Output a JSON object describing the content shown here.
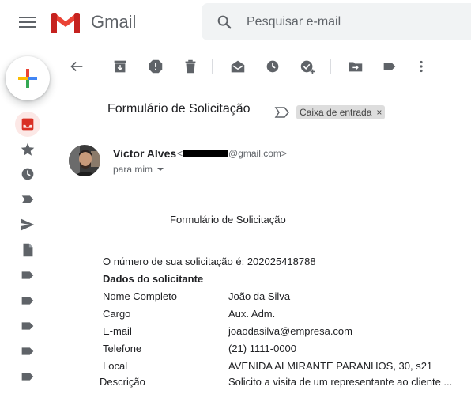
{
  "header": {
    "app_name": "Gmail",
    "search_placeholder": "Pesquisar e-mail"
  },
  "icons": {
    "menu": "hamburger-menu-icon",
    "logo": "gmail-logo-icon",
    "search": "search-icon",
    "compose": "plus-icon",
    "sidebar": [
      "inbox-icon",
      "star-icon",
      "clock-icon",
      "label-important-icon",
      "send-icon",
      "draft-icon",
      "label-icon",
      "label-icon",
      "label-icon",
      "label-icon",
      "label-icon"
    ],
    "toolbar": [
      "back-arrow-icon",
      "archive-icon",
      "report-spam-icon",
      "delete-icon",
      "mark-unread-icon",
      "snooze-icon",
      "add-task-icon",
      "move-to-icon",
      "label-icon",
      "more-vert-icon"
    ]
  },
  "colors": {
    "accent": "#d93025",
    "chip_bg": "#dddddd",
    "search_bg": "#f1f3f4"
  },
  "email": {
    "subject": "Formulário de Solicitação",
    "label": "Caixa de entrada",
    "label_remove": "×",
    "sender_name": "Victor Alves",
    "sender_email_prefix": "<",
    "sender_email_suffix": "@gmail.com>",
    "recipient": "para mim"
  },
  "body": {
    "title": "Formulário de Solicitação",
    "request_line": "O número de sua solicitação é: 202025418788",
    "section_heading": "Dados do solicitante",
    "fields": [
      {
        "label": "Nome Completo",
        "value": "João da Silva"
      },
      {
        "label": "Cargo",
        "value": "Aux. Adm."
      },
      {
        "label": "E-mail",
        "value": "joaodasilva@empresa.com"
      },
      {
        "label": "Telefone",
        "value": "(21) 1111-0000"
      },
      {
        "label": "Local",
        "value": "AVENIDA ALMIRANTE PARANHOS, 30, s21"
      },
      {
        "label": "Descrição",
        "value": "Solicito a visita de um representante ao cliente ..."
      }
    ]
  }
}
